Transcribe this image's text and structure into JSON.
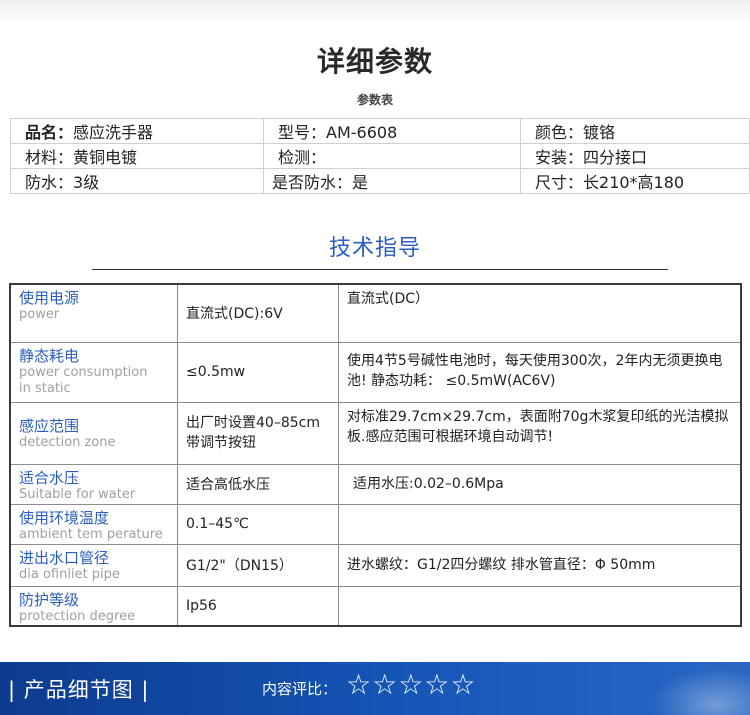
{
  "header": {
    "title": "详细参数",
    "subtitle": "参数表"
  },
  "spec": [
    [
      {
        "label": "品名：",
        "value": "感应洗手器"
      },
      {
        "label": "型号：",
        "value": "AM-6608"
      },
      {
        "label": "颜色：",
        "value": "镀铬"
      }
    ],
    [
      {
        "label": "材料：",
        "value": "黄铜电镀"
      },
      {
        "label": "检测：",
        "value": ""
      },
      {
        "label": "安装：",
        "value": "四分接口"
      }
    ],
    [
      {
        "label": "防水：",
        "value": "3级"
      },
      {
        "label": "是否防水：",
        "value": "是"
      },
      {
        "label": "尺寸：",
        "value": "长210*高180"
      }
    ]
  ],
  "tech": {
    "title": "技术指导",
    "rows": [
      {
        "zh": "使用电源",
        "en": "power",
        "value": "直流式(DC):6V",
        "desc": "直流式(DC）"
      },
      {
        "zh": "静态耗电",
        "en": "power consumption in static",
        "value": "≤0.5mw",
        "desc": "使用4节5号碱性电池时，每天使用300次，2年内无须更换电池! 静态功耗：  ≤0.5mW(AC6V)"
      },
      {
        "zh": "感应范围",
        "en": "detection zone",
        "value": "出厂时设置40–85cm 带调节按钮",
        "desc": "对标准29.7cm×29.7cm，表面附70g木浆复印纸的光洁模拟板.感应范围可根据环境自动调节!"
      },
      {
        "zh": "适合水压",
        "en": "Suitable for water",
        "value": "适合高低水压",
        "desc": "适用水压:0.02–0.6Mpa"
      },
      {
        "zh": "使用环境温度",
        "en": "ambient tem perature",
        "value": "0.1–45℃",
        "desc": ""
      },
      {
        "zh": "进出水口管径",
        "en": "dia ofinliet pipe",
        "value": "G1/2\"（DN15）",
        "desc": "进水螺纹：G1/2四分螺纹  排水管直径：Φ 50mm"
      },
      {
        "zh": "防护等级",
        "en": "protection degree",
        "value": "Ip56",
        "desc": ""
      }
    ]
  },
  "footer": {
    "title": "| 产品细节图 |",
    "rating_label": "内容评比：",
    "stars": "☆☆☆☆☆"
  },
  "colors": {
    "accent_blue": "#2a5fbf",
    "footer_bar": "#1556b8"
  }
}
